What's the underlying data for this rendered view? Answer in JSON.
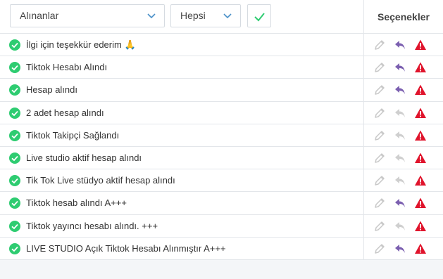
{
  "filters": {
    "type_select": "Alınanlar",
    "status_select": "Hepsi"
  },
  "table": {
    "options_header": "Seçenekler",
    "rows": [
      {
        "text": "İlgi için teşekkür ederim 🙏",
        "reply_active": true
      },
      {
        "text": "Tiktok Hesabı Alındı",
        "reply_active": true
      },
      {
        "text": "Hesap alındı",
        "reply_active": true
      },
      {
        "text": "2 adet hesap alındı",
        "reply_active": false
      },
      {
        "text": "Tiktok Takipçi Sağlandı",
        "reply_active": false
      },
      {
        "text": "Live studio aktif hesap alındı",
        "reply_active": false
      },
      {
        "text": "Tik Tok Live stüdyo aktif hesap alındı",
        "reply_active": false
      },
      {
        "text": "Tiktok hesab alındı A+++",
        "reply_active": true
      },
      {
        "text": "Tiktok yayıncı hesabı alındı. +++",
        "reply_active": false
      },
      {
        "text": "LIVE STUDIO Açık Tiktok Hesabı Alınmıştır A+++",
        "reply_active": true
      }
    ]
  },
  "colors": {
    "check_green": "#2ecc71",
    "reply_active": "#7b5fb0",
    "reply_inactive": "#cfcfcf",
    "edit_gray": "#c8c8c8",
    "warn_red": "#e0142c",
    "chevron_blue": "#4a90c8"
  },
  "icons": {
    "row_status": "check-circle-icon",
    "edit": "pencil-icon",
    "reply": "reply-icon",
    "report": "warning-triangle-icon"
  }
}
